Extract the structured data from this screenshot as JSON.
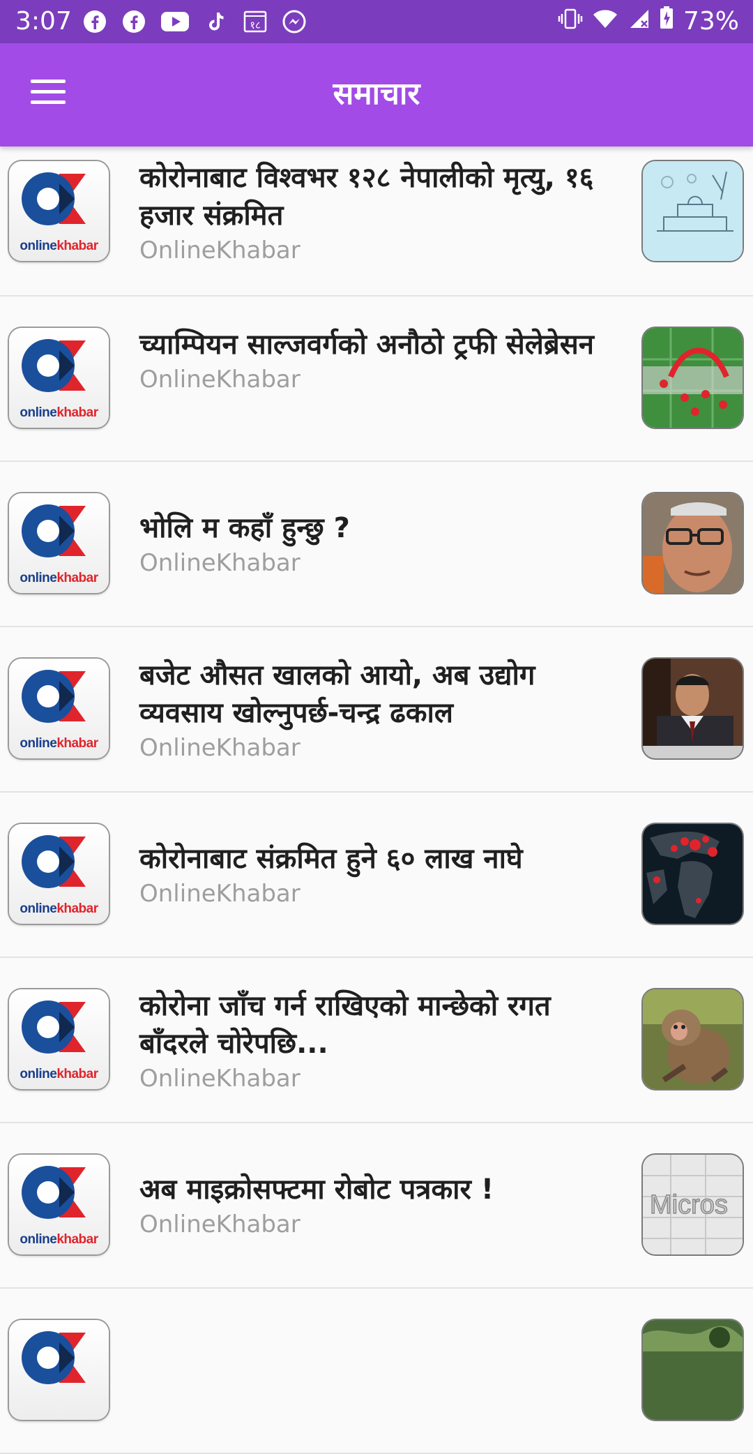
{
  "status_bar": {
    "time": "3:07",
    "left_icons": [
      "facebook-icon",
      "facebook-icon",
      "youtube-icon",
      "tiktok-icon",
      "calendar-icon",
      "messenger-icon"
    ],
    "calendar_text": "१८",
    "battery": "73%"
  },
  "app_bar": {
    "title": "समाचार"
  },
  "articles": [
    {
      "title": "कोरोनाबाट विश्वभर १२८ नेपालीको मृत्यु, १६ हजार संक्रमित",
      "source": "OnlineKhabar"
    },
    {
      "title": "च्याम्पियन साल्जवर्गको अनौठो ट्रफी सेलेब्रेसन",
      "source": "OnlineKhabar"
    },
    {
      "title": "भोलि म कहाँ हुन्छु ?",
      "source": "OnlineKhabar"
    },
    {
      "title": "बजेट औसत खालको आयो, अब उद्योग व्यवसाय खोल्नुपर्छ-चन्द्र ढकाल",
      "source": "OnlineKhabar"
    },
    {
      "title": "कोरोनाबाट संक्रमित हुने ६० लाख नाघे",
      "source": "OnlineKhabar"
    },
    {
      "title": "कोरोना जाँच गर्न राखिएको मान्छेको रगत बाँदरले चोरेपछि...",
      "source": "OnlineKhabar"
    },
    {
      "title": "अब माइक्रोसफ्टमा रोबोट पत्रकार !",
      "source": "OnlineKhabar"
    }
  ],
  "logo_text": {
    "part1": "online",
    "part2": "khabar"
  },
  "thumb_text": {
    "microsoft": "Micros"
  },
  "colors": {
    "status_bar": "#7b3dbd",
    "app_bar": "#a24be6",
    "source_text": "#9e9e9e",
    "logo_blue": "#1a4f9c",
    "logo_red": "#e0242c"
  }
}
